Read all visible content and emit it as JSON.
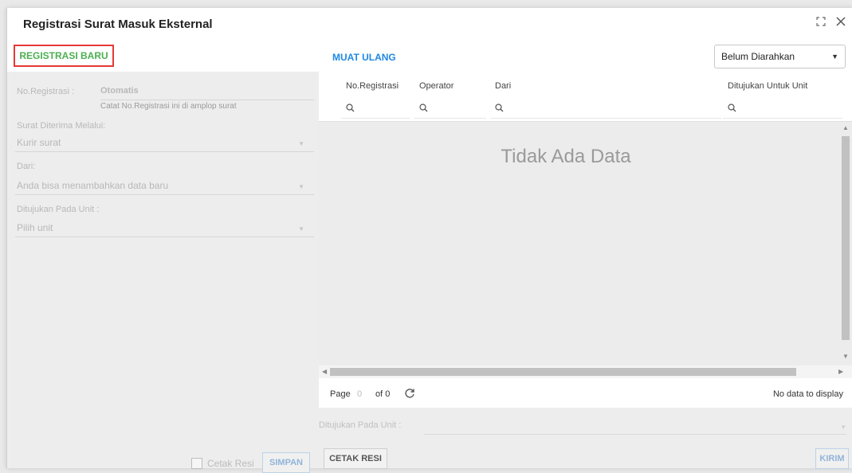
{
  "dialog": {
    "title": "Registrasi Surat Masuk Eksternal"
  },
  "toolbar": {
    "register_new": "REGISTRASI BARU",
    "reload": "MUAT ULANG",
    "filter_value": "Belum Diarahkan"
  },
  "form": {
    "no_registrasi_label": "No.Registrasi :",
    "no_registrasi_value": "Otomatis",
    "no_registrasi_hint": "Catat No.Registrasi ini di amplop surat",
    "diterima_label": "Surat Diterima Melalui:",
    "diterima_value": "Kurir surat",
    "dari_label": "Dari:",
    "dari_value": "Anda bisa menambahkan data baru",
    "unit_label": "Ditujukan Pada Unit :",
    "unit_value": "Pilih unit",
    "cetak_resi_label": "Cetak Resi",
    "simpan_label": "SIMPAN"
  },
  "grid": {
    "columns": [
      "No.Registrasi",
      "Operator",
      "Dari",
      "Ditujukan Untuk Unit"
    ],
    "empty_text": "Tidak Ada Data"
  },
  "pager": {
    "page_label": "Page",
    "page_value": "0",
    "of_label": "of 0",
    "status": "No data to display"
  },
  "bottom": {
    "unit_label": "Ditujukan Pada Unit :",
    "cetak_resi": "CETAK RESI",
    "kirim": "KIRIM"
  }
}
